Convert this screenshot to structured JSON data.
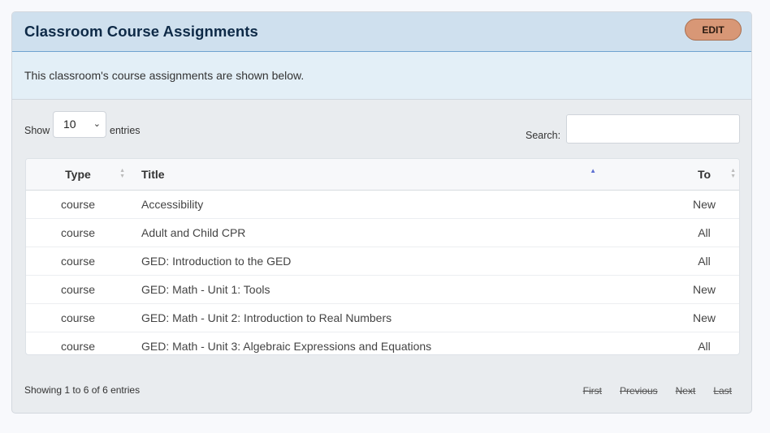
{
  "panel": {
    "title": "Classroom Course Assignments",
    "edit_label": "EDIT",
    "description": "This classroom's course assignments are shown below."
  },
  "controls": {
    "show_label": "Show",
    "page_size": "10",
    "entries_label": "entries",
    "search_label": "Search:",
    "search_value": ""
  },
  "table": {
    "headers": {
      "type": "Type",
      "title": "Title",
      "to": "To"
    },
    "rows": [
      {
        "type": "course",
        "title": "Accessibility",
        "to": "New"
      },
      {
        "type": "course",
        "title": "Adult and Child CPR",
        "to": "All"
      },
      {
        "type": "course",
        "title": "GED: Introduction to the GED",
        "to": "All"
      },
      {
        "type": "course",
        "title": "GED: Math - Unit 1: Tools",
        "to": "New"
      },
      {
        "type": "course",
        "title": "GED: Math - Unit 2: Introduction to Real Numbers",
        "to": "New"
      },
      {
        "type": "course",
        "title": "GED: Math - Unit 3: Algebraic Expressions and Equations",
        "to": "All"
      }
    ]
  },
  "footer": {
    "info": "Showing 1 to 6 of 6 entries",
    "first": "First",
    "previous": "Previous",
    "next": "Next",
    "last": "Last"
  },
  "colors": {
    "header_bg": "#cfe0ee",
    "edit_button": "#d89776",
    "sort_active": "#5b6fd1"
  },
  "icons": {
    "sort_active": "sort-ascending-icon",
    "sort_inactive": "sort-both-icon",
    "select": "chevron-down-icon"
  }
}
